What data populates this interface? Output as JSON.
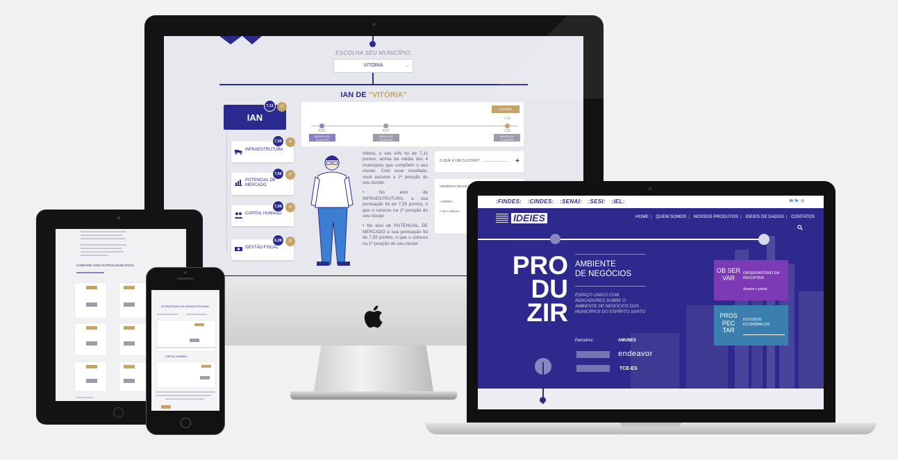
{
  "desktop": {
    "choose_label": "ESCOLHA SEU MUNICÍPIO:",
    "selected_municipio": "VITÓRIA",
    "ian_title_prefix": "IAN DE ",
    "ian_title_city": "\"VITÓRIA\"",
    "ian_card": {
      "label": "IAN",
      "value": "7,11",
      "rank": "1º"
    },
    "axes": [
      {
        "label": "INFRAESTRUTURA",
        "value": "7,55",
        "rank": "1º"
      },
      {
        "label": "POTENCIAL DE MERCADO",
        "value": "7,55",
        "rank": "1º"
      },
      {
        "label": "CAPITAL HUMANO",
        "value": "7,09",
        "rank": "1º"
      },
      {
        "label": "GESTÃO FISCAL",
        "value": "6,28",
        "rank": "3º"
      }
    ],
    "chart": {
      "top_label": "VITÓRIA",
      "points": [
        {
          "value": "5,51",
          "label": "MENOR DO CLUSTER"
        },
        {
          "value": "6,07",
          "label": "MÉDIA DO CLUSTER"
        },
        {
          "value": "7,11",
          "label": "MAIOR DO CLUSTER"
        }
      ],
      "marker_value": "7,11"
    },
    "paragraphs": [
      "Vitória, o seu IAN foi de 7,11 pontos, acima da média dos 4 municípios que compõem o seu cluster. Com esse resultado, você assume a 1ª posição do seu cluster.",
      "• No eixo de INFRAESTRUTURA, a sua pontuação foi de 7,55 pontos, o que o colocou na 1ª posição do seu cluster.",
      "• No eixo de POTENCIAL DE MERCADO a sua pontuação foi de 7,55 pontos, o que o colocou na 1ª posição do seu cluster."
    ],
    "side_card": {
      "label": "O QUE É UM CLUSTER?",
      "plus": "+"
    },
    "side_card2": {
      "title": "MEMBROS DESSE CLUSTER",
      "items": [
        "• SERRA",
        "• VILA VELHA"
      ]
    }
  },
  "tablet": {
    "section_title": "COMPARE COM OUTROS MUNICÍPIOS"
  },
  "phone": {
    "title": "ESTRATÉGIAS EM INFRAESTRUTURA",
    "subtitle": "CAPITAL HUMANO"
  },
  "laptop": {
    "brands": [
      ":FINDES:",
      ":CINDES:",
      ":SENAI:",
      ":SESI:",
      ":IEL:"
    ],
    "social": "in  🐦  ◎",
    "logo": "IDEIES",
    "menu": [
      "HOME",
      "QUEM SOMOS",
      "NOSSOS PRODUTOS",
      "IDEIES DE DADOS",
      "CONTATOS"
    ],
    "hero_big": [
      "PRO",
      "DU",
      "ZIR"
    ],
    "hero_title_1": "AMBIENTE",
    "hero_title_2": "DE NEGÓCIOS",
    "hero_desc": "ESPAÇO ÚNICO COM INDICADORES SOBRE O AMBIENTE DE NEGÓCIOS DOS MUNICÍPIOS DO ESPÍRITO SANTO",
    "parceiros_label": "Parceiros:",
    "partners": [
      "AMUNES",
      "endeavor",
      "TCE-ES"
    ],
    "card1": {
      "big": "OB SER VAR",
      "small": "OBSERVATÓRIO DA INDÚSTRIA",
      "link": "Acesse o portal"
    },
    "card2": {
      "big": "PROS PEC TAR",
      "small": "ESTUDOS ECONÔMICOS"
    }
  },
  "colors": {
    "primary": "#2e2a8d",
    "gold": "#c5a46b",
    "purple": "#7c3ab5",
    "teal": "#3a7fae"
  }
}
